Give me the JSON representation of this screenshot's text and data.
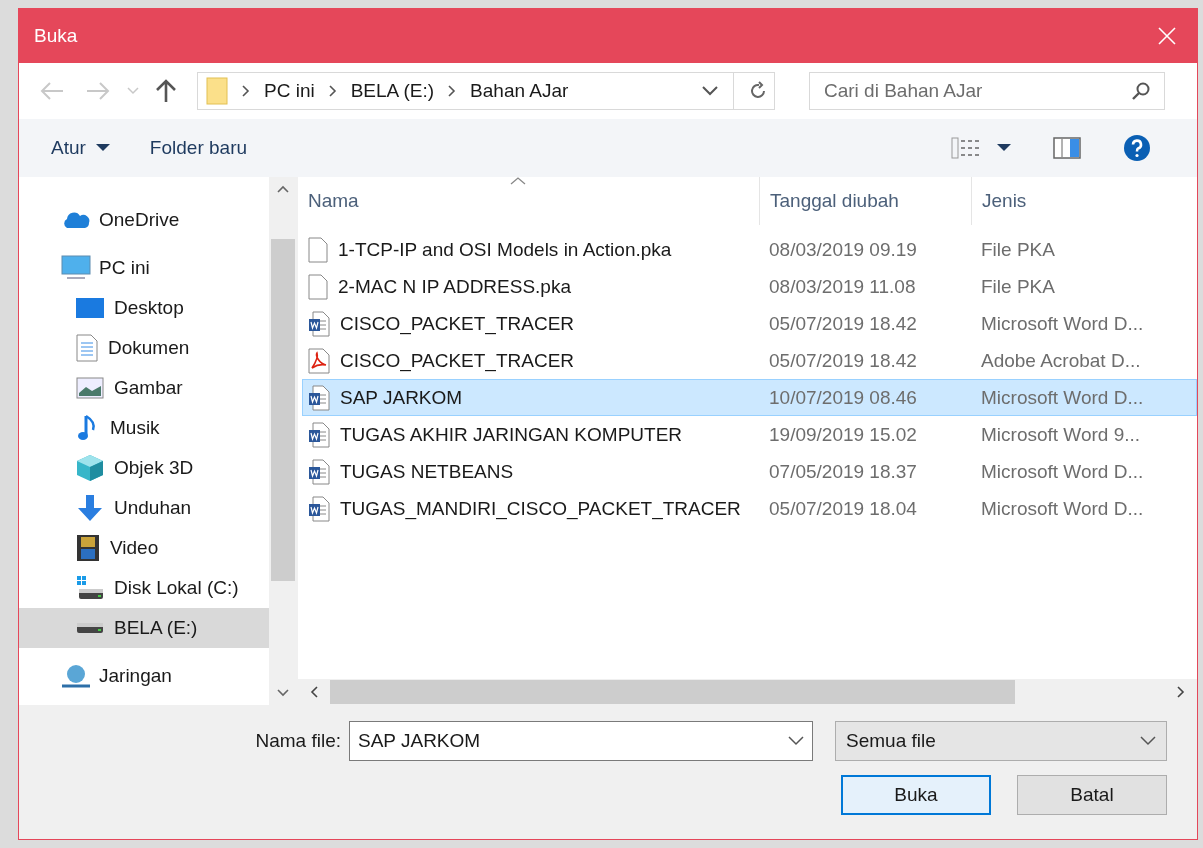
{
  "window": {
    "title": "Buka"
  },
  "breadcrumb": [
    "PC ini",
    "BELA (E:)",
    "Bahan AJar"
  ],
  "search": {
    "placeholder": "Cari di Bahan AJar"
  },
  "toolbar": {
    "organize": "Atur",
    "new_folder": "Folder baru"
  },
  "sidebar": {
    "items": [
      {
        "label": "OneDrive",
        "kind": "cloud",
        "selected": false
      },
      {
        "label": "PC ini",
        "kind": "pc",
        "selected": false,
        "children": [
          {
            "label": "Desktop",
            "kind": "desktop",
            "selected": false
          },
          {
            "label": "Dokumen",
            "kind": "document",
            "selected": false
          },
          {
            "label": "Gambar",
            "kind": "picture",
            "selected": false
          },
          {
            "label": "Musik",
            "kind": "music",
            "selected": false
          },
          {
            "label": "Objek 3D",
            "kind": "cube",
            "selected": false
          },
          {
            "label": "Unduhan",
            "kind": "download",
            "selected": false
          },
          {
            "label": "Video",
            "kind": "film",
            "selected": false
          },
          {
            "label": "Disk Lokal (C:)",
            "kind": "systemdrive",
            "selected": false
          },
          {
            "label": "BELA (E:)",
            "kind": "drive",
            "selected": true
          }
        ]
      },
      {
        "label": "Jaringan",
        "kind": "network",
        "selected": false
      }
    ]
  },
  "table": {
    "columns": [
      "Nama",
      "Tanggal diubah",
      "Jenis"
    ],
    "rows": [
      {
        "name": "1-TCP-IP and OSI Models in Action.pka",
        "date": "08/03/2019 09.19",
        "type": "File PKA",
        "kind": "blank",
        "selected": false
      },
      {
        "name": "2-MAC N IP ADDRESS.pka",
        "date": "08/03/2019 11.08",
        "type": "File PKA",
        "kind": "blank",
        "selected": false
      },
      {
        "name": "CISCO_PACKET_TRACER",
        "date": "05/07/2019 18.42",
        "type": "Microsoft Word D...",
        "kind": "word",
        "selected": false
      },
      {
        "name": "CISCO_PACKET_TRACER",
        "date": "05/07/2019 18.42",
        "type": "Adobe Acrobat D...",
        "kind": "pdf",
        "selected": false
      },
      {
        "name": "SAP JARKOM",
        "date": "10/07/2019 08.46",
        "type": "Microsoft Word D...",
        "kind": "word",
        "selected": true
      },
      {
        "name": "TUGAS AKHIR JARINGAN KOMPUTER",
        "date": "19/09/2019 15.02",
        "type": "Microsoft Word 9...",
        "kind": "word",
        "selected": false
      },
      {
        "name": "TUGAS NETBEANS",
        "date": "07/05/2019 18.37",
        "type": "Microsoft Word D...",
        "kind": "word",
        "selected": false
      },
      {
        "name": "TUGAS_MANDIRI_CISCO_PACKET_TRACER",
        "date": "05/07/2019 18.04",
        "type": "Microsoft Word D...",
        "kind": "word",
        "selected": false
      }
    ]
  },
  "filename": {
    "label": "Nama file:",
    "value": "SAP JARKOM"
  },
  "filetype": {
    "value": "Semua file"
  },
  "buttons": [
    {
      "label": "Buka",
      "kind": "primary"
    },
    {
      "label": "Batal",
      "kind": "normal"
    }
  ]
}
